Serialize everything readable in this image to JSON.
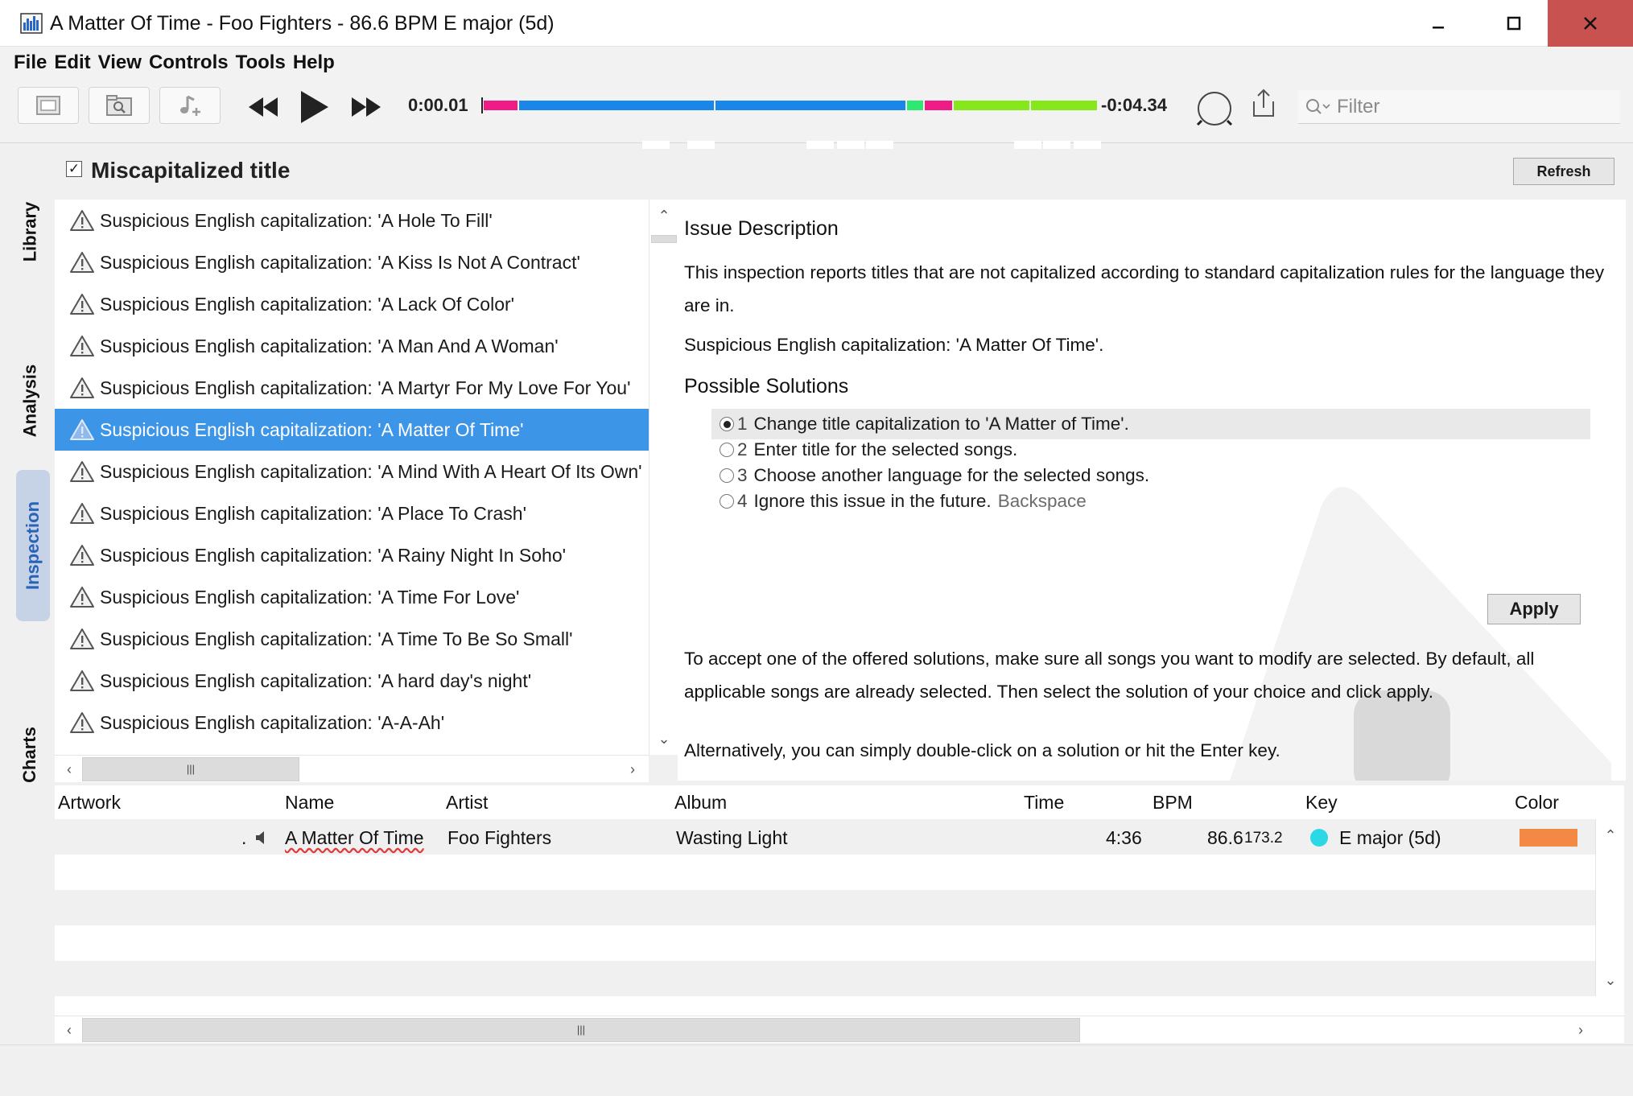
{
  "window": {
    "title": "A Matter Of Time - Foo Fighters - 86.6 BPM E major (5d)",
    "controls": {
      "minimize": "▁",
      "maximize": "☐",
      "close": "✕"
    }
  },
  "menu": [
    "File",
    "Edit",
    "View",
    "Controls",
    "Tools",
    "Help"
  ],
  "player": {
    "elapsed": "0:00.01",
    "remaining": "-0:04.34",
    "filter_placeholder": "Filter",
    "segment_colors": {
      "pink": "#ee1c84",
      "blue": "#1a86e8",
      "green": "#2ee870",
      "lime": "#86e81a"
    }
  },
  "side_tabs": [
    "Library",
    "Analysis",
    "Inspection",
    "Charts"
  ],
  "inspection": {
    "checked": "✓",
    "title": "Miscapitalized title",
    "refresh_label": "Refresh"
  },
  "issues": [
    "Suspicious English capitalization: 'A Hole To Fill'",
    "Suspicious English capitalization: 'A Kiss Is Not A Contract'",
    "Suspicious English capitalization: 'A Lack Of Color'",
    "Suspicious English capitalization: 'A Man And A Woman'",
    "Suspicious English capitalization: 'A Martyr For My Love For You'",
    "Suspicious English capitalization: 'A Matter Of Time'",
    "Suspicious English capitalization: 'A Mind With A Heart Of Its Own'",
    "Suspicious English capitalization: 'A Place To Crash'",
    "Suspicious English capitalization: 'A Rainy Night In Soho'",
    "Suspicious English capitalization: 'A Time For Love'",
    "Suspicious English capitalization: 'A Time To Be So Small'",
    "Suspicious English capitalization: 'A hard day's night'",
    "Suspicious English capitalization: 'A-A-Ah'"
  ],
  "description": {
    "heading": "Issue Description",
    "body": "This inspection reports titles that are not capitalized according to standard capitalization rules for the language they are in.",
    "current": "Suspicious English capitalization: 'A Matter Of Time'.",
    "solutions_heading": "Possible Solutions",
    "solutions": [
      {
        "num": "1",
        "text": "Change title capitalization to 'A Matter of Time'.",
        "hint": ""
      },
      {
        "num": "2",
        "text": "Enter title for the selected songs.",
        "hint": ""
      },
      {
        "num": "3",
        "text": "Choose another language for the selected songs.",
        "hint": ""
      },
      {
        "num": "4",
        "text": "Ignore this issue in the future.",
        "hint": "Backspace"
      }
    ],
    "apply_label": "Apply",
    "accept_text": "To accept one of the offered solutions, make sure all songs you want to modify are selected. By default, all applicable songs are already selected. Then select the solution of your choice and click apply.",
    "alt_text": "Alternatively, you can simply double-click on a solution or hit the Enter key."
  },
  "table": {
    "columns": [
      "Artwork",
      "Name",
      "Artist",
      "Album",
      "Time",
      "BPM",
      "Key",
      "Color"
    ],
    "rows": [
      {
        "artwork_dot": ".",
        "name": "A Matter Of Time",
        "artist": "Foo Fighters",
        "album": "Wasting Light",
        "time": "4:36",
        "bpm": "86.6",
        "bpm_alt": "173.2",
        "key": "E major (5d)",
        "key_color": "#2ad8e6",
        "color": "#f28a45"
      }
    ]
  },
  "scroll": {
    "up": "⌃",
    "down": "⌄",
    "left": "‹",
    "right": "›",
    "grip": "|||"
  }
}
